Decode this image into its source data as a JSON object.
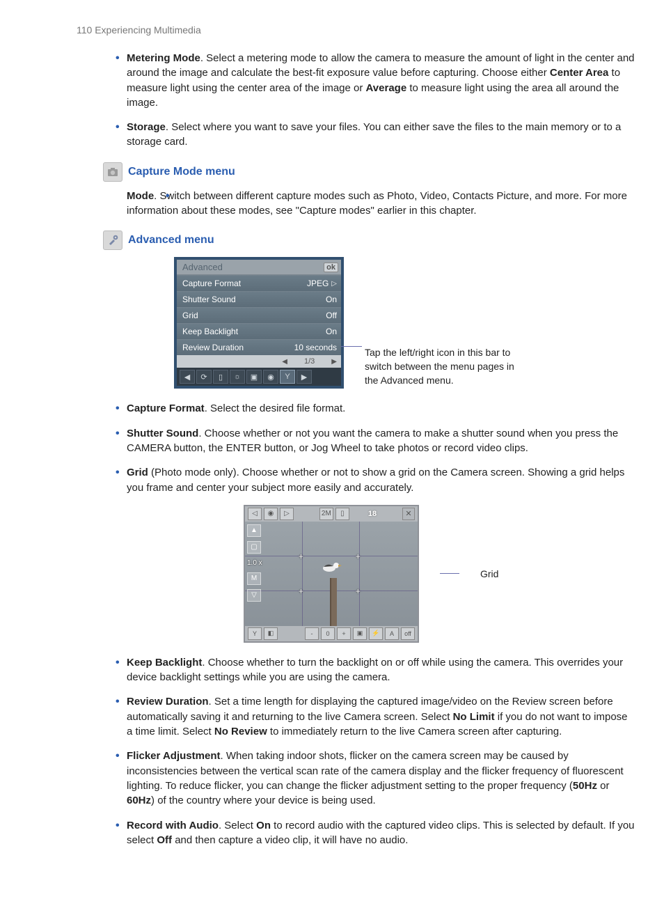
{
  "page_header": "110  Experiencing Multimedia",
  "bullets_top": [
    {
      "bold": "Metering Mode",
      "text": ". Select a metering mode to allow the camera to measure the amount of light in the center and around the image and calculate the best-fit exposure value before capturing. Choose either ",
      "bold2": "Center Area",
      "text2": " to measure light using the center area of the image or ",
      "bold3": "Average",
      "text3": " to measure light using the area all around the image."
    },
    {
      "bold": "Storage",
      "text": ". Select where you want to save your files. You can either save the files to the main memory or to a storage card."
    }
  ],
  "section_capture": {
    "title": "Capture Mode menu",
    "bullet": {
      "bold": "Mode",
      "text": ". Switch between different capture modes such as Photo, Video, Contacts Picture, and more. For more information about these modes, see \"Capture modes\" earlier in this chapter."
    }
  },
  "section_advanced": {
    "title": "Advanced menu",
    "menu": {
      "title": "Advanced",
      "ok": "ok",
      "rows": [
        {
          "label": "Capture Format",
          "value": "JPEG"
        },
        {
          "label": "Shutter Sound",
          "value": "On"
        },
        {
          "label": "Grid",
          "value": "Off"
        },
        {
          "label": "Keep Backlight",
          "value": "On"
        },
        {
          "label": "Review Duration",
          "value": "10 seconds"
        }
      ],
      "pager": "1/3"
    },
    "caption": "Tap the left/right icon in this bar to switch between the menu pages in the Advanced menu."
  },
  "bullets_after_menu": [
    {
      "bold": "Capture Format",
      "text": ". Select the desired file format."
    },
    {
      "bold": "Shutter Sound",
      "text": ". Choose whether or not you want the camera to make a shutter sound when you press the CAMERA button, the ENTER button, or Jog Wheel to take photos or record video clips."
    },
    {
      "bold": "Grid",
      "text": " (Photo mode only). Choose whether or not to show a grid on the Camera screen. Showing a grid helps you frame and center your subject more easily and accurately."
    }
  ],
  "camera": {
    "counter": "18",
    "zoom": "1.0 x",
    "grid_label": "Grid"
  },
  "bullets_after_camera": [
    {
      "bold": "Keep Backlight",
      "text": ". Choose whether to turn the backlight on or off while using the camera. This overrides your device backlight settings while you are using the camera."
    },
    {
      "bold": "Review Duration",
      "text": ". Set a time length for displaying the captured image/video on the Review screen before automatically saving it and returning to the live Camera screen. Select ",
      "bold2": "No Limit",
      "text2": " if you do not want to impose a time limit. Select ",
      "bold3": "No Review",
      "text3": "  to immediately return to the live Camera screen after capturing."
    },
    {
      "bold": "Flicker Adjustment",
      "text": ". When taking indoor shots, flicker on the camera screen may be caused by inconsistencies between the vertical scan rate of the camera display and the flicker frequency of fluorescent lighting. To reduce flicker, you can change the flicker adjustment setting to the proper frequency (",
      "bold2": "50Hz",
      "text2": " or ",
      "bold3": "60Hz",
      "text3": ") of the country where your device is being used."
    },
    {
      "bold": "Record with Audio",
      "text": ". Select ",
      "bold2": "On",
      "text2": " to record audio with the captured video clips. This is selected by default. If you select ",
      "bold3": "Off",
      "text3": " and then capture a video clip, it will have no audio."
    }
  ]
}
